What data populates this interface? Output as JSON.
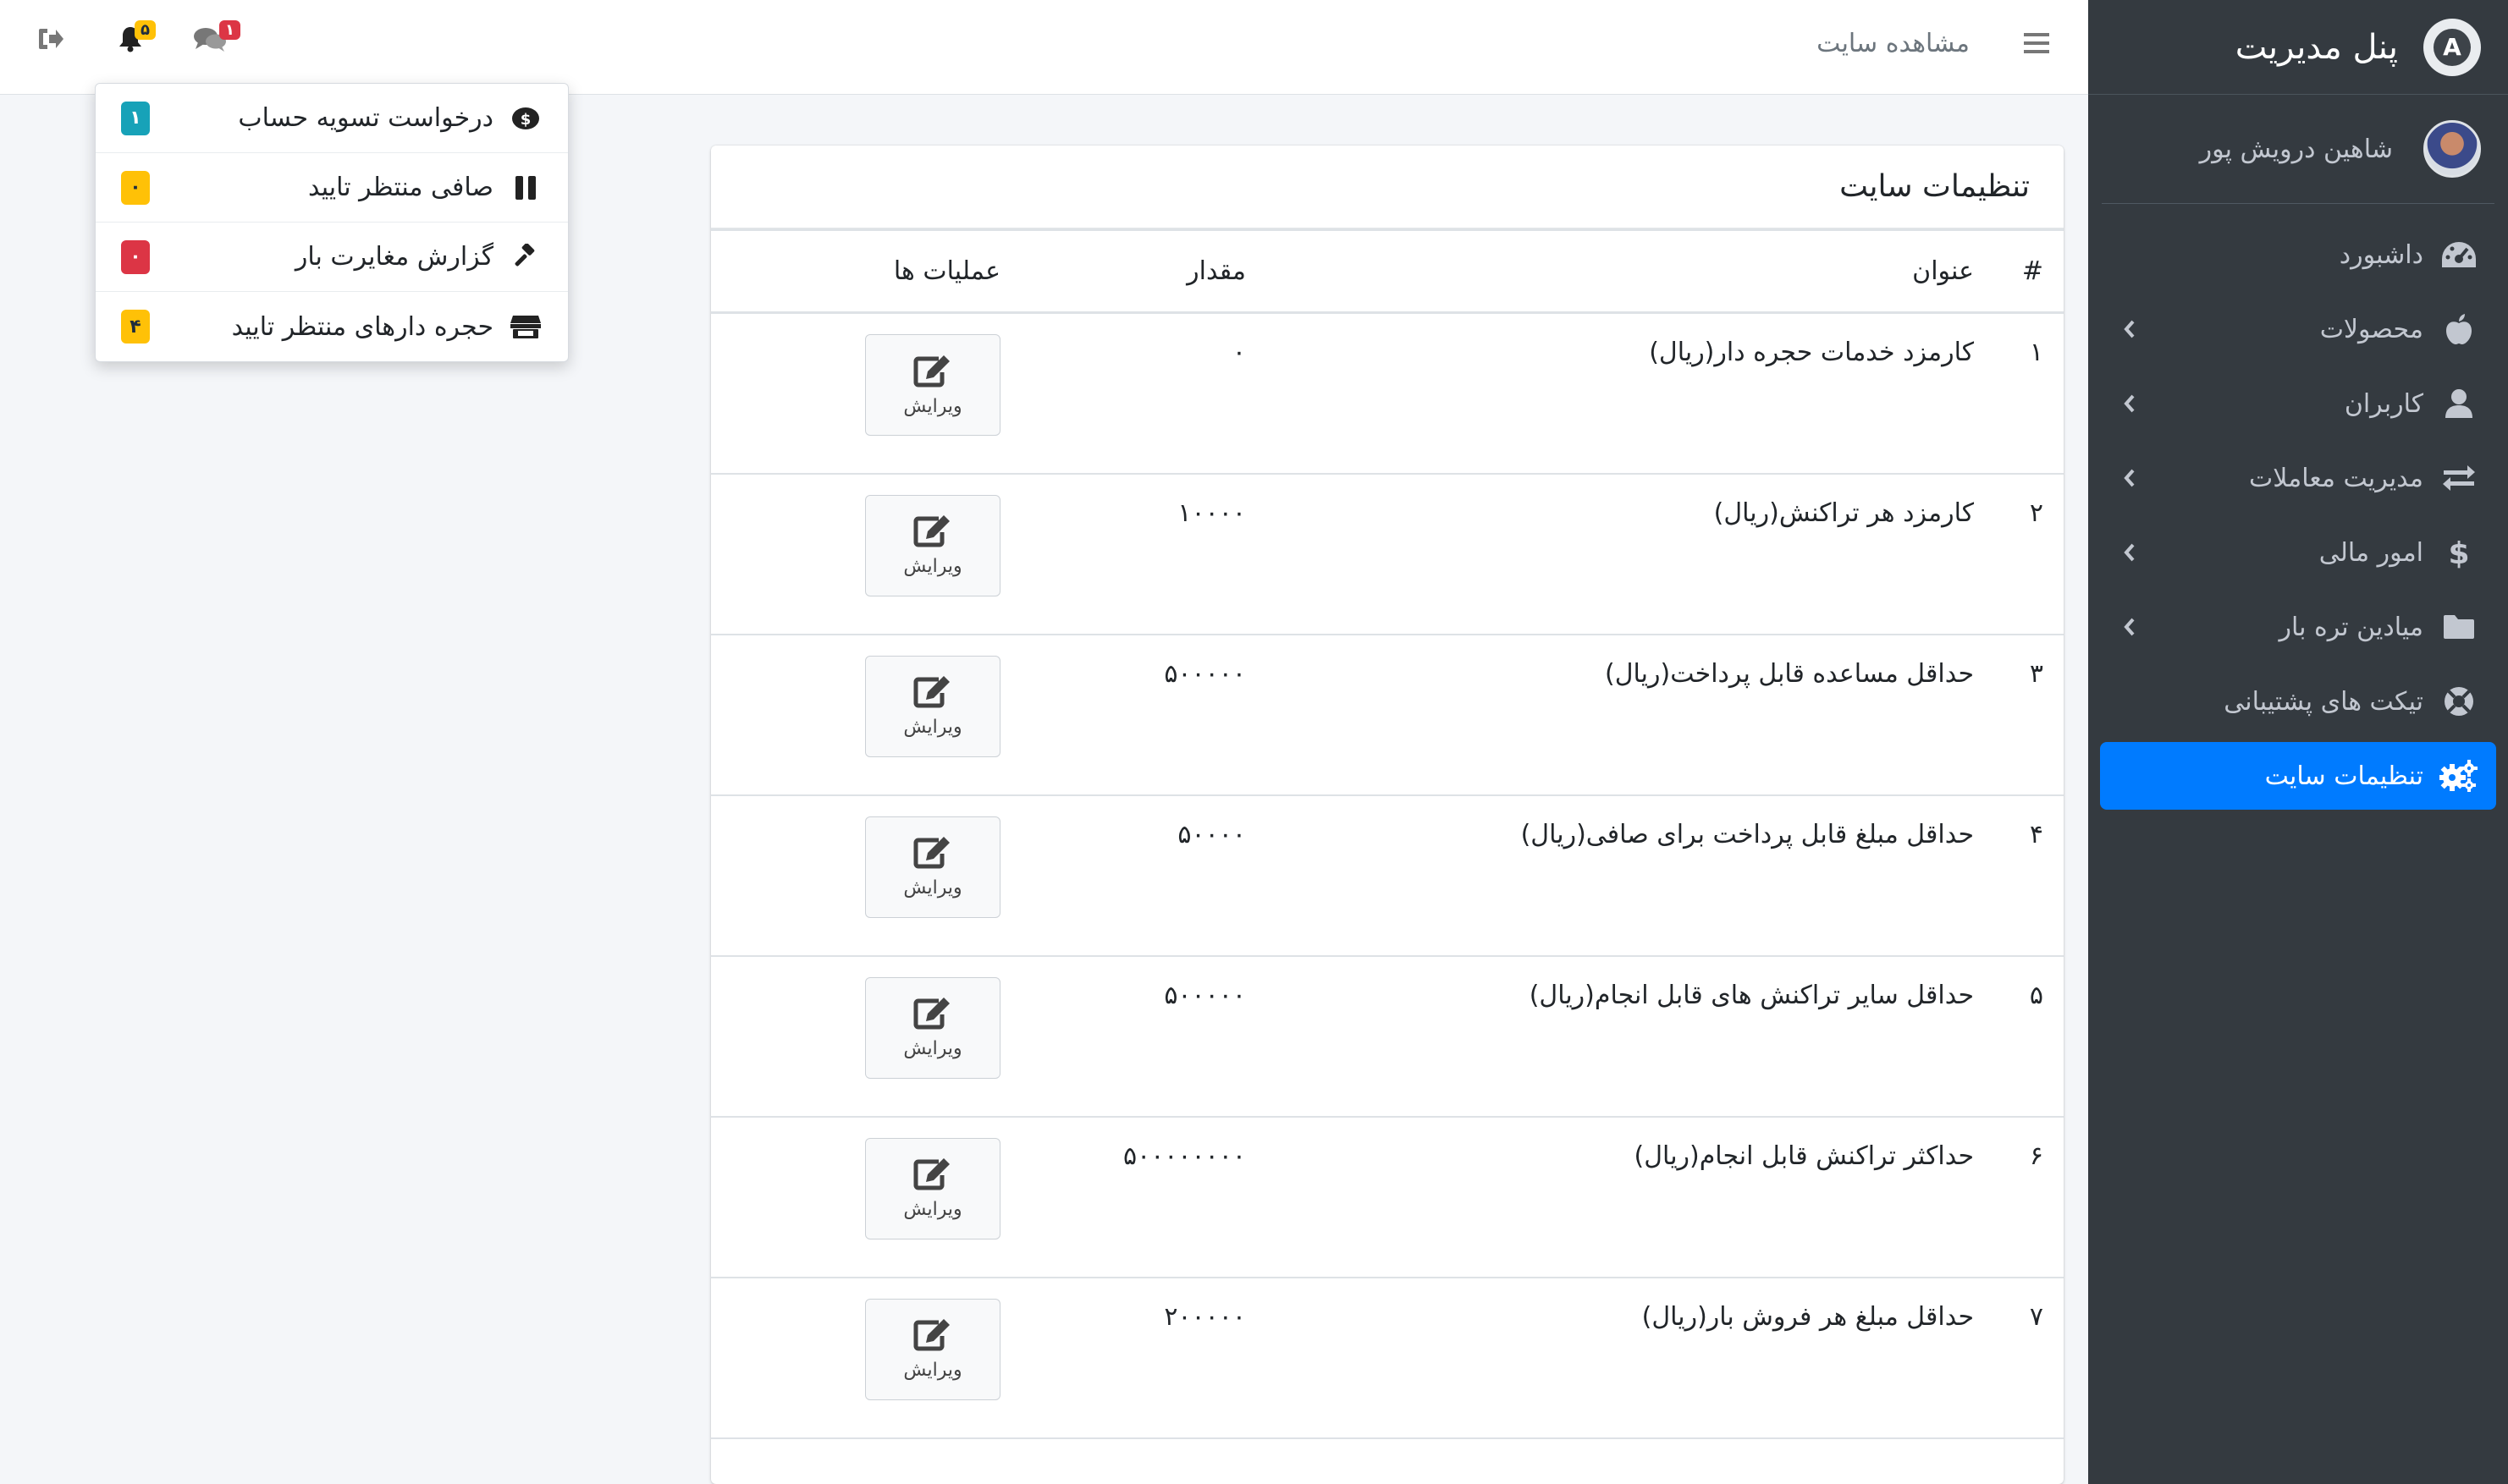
{
  "sidebar": {
    "brand": "پنل مدیریت",
    "logo_letter": "A",
    "user_name": "شاهین درویش پور",
    "items": [
      {
        "label": "داشبورد",
        "icon": "tachometer-icon",
        "arrow": false,
        "active": false
      },
      {
        "label": "محصولات",
        "icon": "apple-icon",
        "arrow": true,
        "active": false
      },
      {
        "label": "کاربران",
        "icon": "user-icon",
        "arrow": true,
        "active": false
      },
      {
        "label": "مدیریت معاملات",
        "icon": "exchange-icon",
        "arrow": true,
        "active": false
      },
      {
        "label": "امور مالی",
        "icon": "dollar-icon",
        "arrow": true,
        "active": false
      },
      {
        "label": "میادین تره بار",
        "icon": "folder-icon",
        "arrow": true,
        "active": false
      },
      {
        "label": "تیکت های پشتیبانی",
        "icon": "life-ring-icon",
        "arrow": false,
        "active": false
      },
      {
        "label": "تنظیمات سایت",
        "icon": "gears-icon",
        "arrow": false,
        "active": true
      }
    ]
  },
  "navbar": {
    "view_site": "مشاهده سایت",
    "messages_badge": "۱",
    "notifications_badge": "۵"
  },
  "dropdown": {
    "items": [
      {
        "label": "درخواست تسویه حساب",
        "icon": "money-icon",
        "badge": "۱",
        "badge_color": "#17a2b8"
      },
      {
        "label": "صافی منتظر تایید",
        "icon": "pause-icon",
        "badge": "۰",
        "badge_color": "#ffc107"
      },
      {
        "label": "گزارش مغایرت بار",
        "icon": "gavel-icon",
        "badge": "۰",
        "badge_color": "#dc3545"
      },
      {
        "label": "حجره دارهای منتظر تایید",
        "icon": "store-icon",
        "badge": "۴",
        "badge_color": "#ffc107"
      }
    ]
  },
  "card": {
    "title": "تنظیمات سایت",
    "columns": [
      "#",
      "عنوان",
      "مقدار",
      "عملیات ها"
    ],
    "edit_label": "ویرایش",
    "rows": [
      {
        "num": "۱",
        "title": "کارمزد خدمات حجره دار(ریال)",
        "value": "۰"
      },
      {
        "num": "۲",
        "title": "کارمزد هر تراکنش(ریال)",
        "value": "۱۰۰۰۰"
      },
      {
        "num": "۳",
        "title": "حداقل مساعده قابل پرداخت(ریال)",
        "value": "۵۰۰۰۰۰"
      },
      {
        "num": "۴",
        "title": "حداقل مبلغ قابل پرداخت برای صافی(ریال)",
        "value": "۵۰۰۰۰"
      },
      {
        "num": "۵",
        "title": "حداقل سایر تراکنش های قابل انجام(ریال)",
        "value": "۵۰۰۰۰۰"
      },
      {
        "num": "۶",
        "title": "حداکثر تراکنش قابل انجام(ریال)",
        "value": "۵۰۰۰۰۰۰۰۰"
      },
      {
        "num": "۷",
        "title": "حداقل مبلغ هر فروش بار(ریال)",
        "value": "۲۰۰۰۰۰"
      }
    ]
  }
}
